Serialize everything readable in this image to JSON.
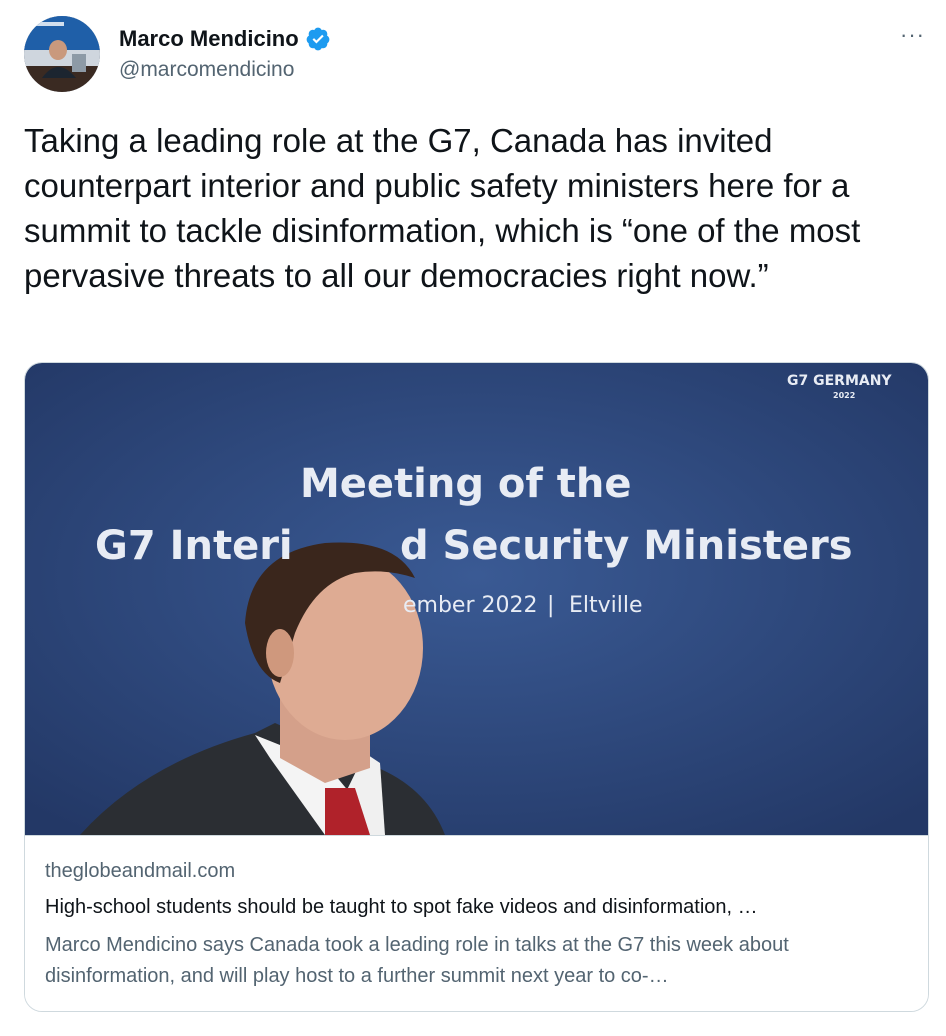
{
  "author": {
    "display_name": "Marco Mendicino",
    "handle": "@marcomendicino",
    "verified": true,
    "avatar_icon": "profile-photo"
  },
  "menu": {
    "more_label": "···"
  },
  "tweet": {
    "text": "Taking a leading role at the G7, Canada has invited counterpart interior and public safety ministers here for a summit to tackle disinformation, which is “one of the most pervasive threats to all our democracies right now.”"
  },
  "card": {
    "image_text": {
      "brand": "G7 GERMANY",
      "brand_year": "2022",
      "line1": "Meeting of the",
      "line2_left": "G7 Interi",
      "line2_right": "d Security Ministers",
      "line3_left": "ember 2022",
      "line3_sep": "|",
      "line3_right": "Eltville"
    },
    "domain": "theglobeandmail.com",
    "title": "High-school students should be taught to spot fake videos and disinformation, …",
    "description": "Marco Mendicino says Canada took a leading role in talks at the G7 this week about disinformation, and will play host to a further summit next year to co-…"
  },
  "colors": {
    "text_primary": "#0f1419",
    "text_secondary": "#536471",
    "verified_blue": "#1d9bf0",
    "border": "#cfd9de",
    "stage_blue": "#2c4477"
  }
}
